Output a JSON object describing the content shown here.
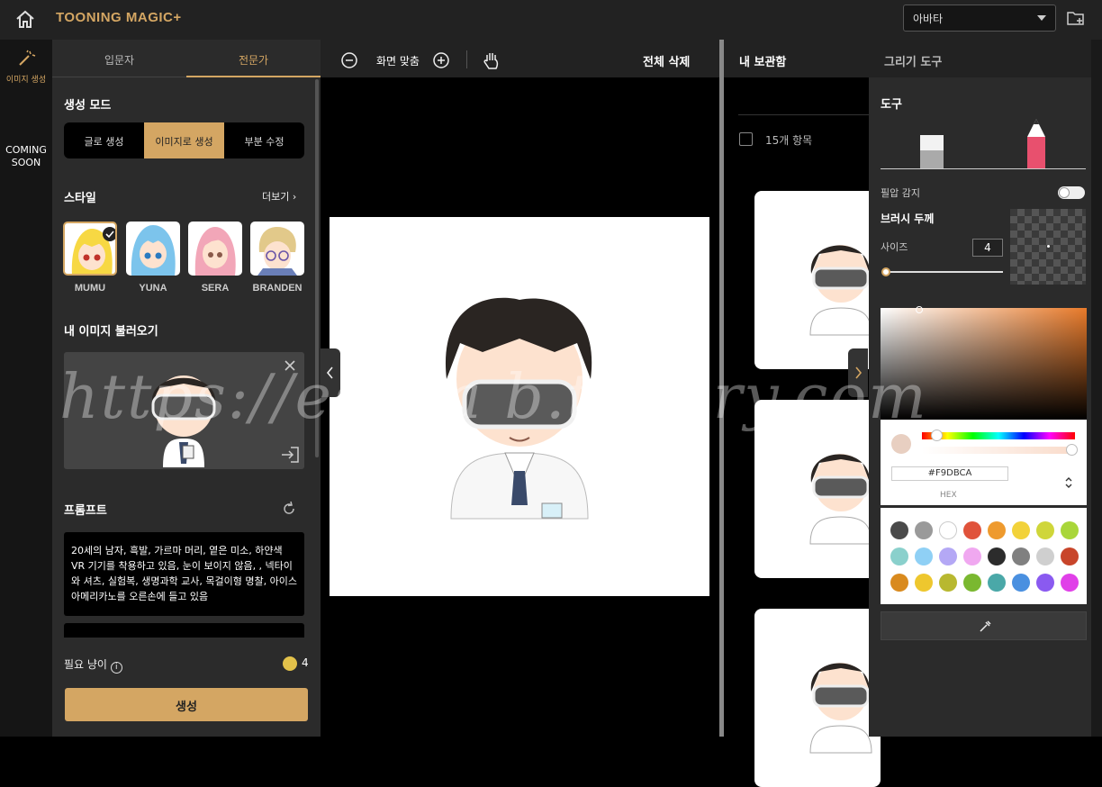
{
  "header": {
    "logo": "TOONING MAGIC+",
    "project_select": "아바타"
  },
  "rail": {
    "items": [
      {
        "label": "이미지 생성"
      }
    ],
    "coming_soon": "COMING SOON"
  },
  "left_panel": {
    "tabs": [
      {
        "label": "입문자"
      },
      {
        "label": "전문가"
      }
    ],
    "mode_title": "생성 모드",
    "modes": [
      {
        "label": "글로 생성"
      },
      {
        "label": "이미지로 생성"
      },
      {
        "label": "부분 수정"
      }
    ],
    "style_title": "스타일",
    "more": "더보기",
    "styles": [
      {
        "name": "MUMU"
      },
      {
        "name": "YUNA"
      },
      {
        "name": "SERA"
      },
      {
        "name": "BRANDEN"
      }
    ],
    "import_title": "내 이미지 불러오기",
    "prompt_title": "프롬프트",
    "prompt_text": "20세의 남자, 흑발, 가르마 머리, 옅은 미소, 하얀색 VR 기기를 착용하고 있음, 눈이 보이지 않음, , 넥타이와 셔츠, 실험복, 생명과학 교사, 목걸이형 명찰, 아이스 아메리카노를 오른손에 들고 있음",
    "cost_label": "필요 냥이",
    "cost_value": "4",
    "generate": "생성"
  },
  "canvas_toolbar": {
    "fit": "화면 맞춤",
    "clear_all": "전체 삭제"
  },
  "library": {
    "tabs": [
      {
        "label": "내 보관함"
      },
      {
        "label": "그리기 도구"
      }
    ],
    "count": "15개 항목"
  },
  "draw_tool": {
    "title": "도구",
    "pressure": "필압 감지",
    "brush_title": "브러시 두께",
    "size_label": "사이즈",
    "size_value": "4",
    "hex_value": "#F9DBCA",
    "hex_label": "HEX"
  },
  "colors": {
    "accent": "#d4a663",
    "current": "#e8cfc1",
    "swatches": [
      "#4a4a4a",
      "#9a9a9a",
      "#ffffff",
      "#e0533b",
      "#ee9a2e",
      "#f2d23a",
      "#cfd63a",
      "#a9d63a",
      "#8ad0cc",
      "#8fd0f5",
      "#b4a8f5",
      "#f0a8f0",
      "#2c2c2c",
      "#808080",
      "#cfcfcf",
      "#c8452a",
      "#d98a1e",
      "#eec72e",
      "#b8b830",
      "#7ab830",
      "#4aa8a8",
      "#4a90e0",
      "#8a5af0",
      "#e040e8"
    ]
  },
  "watermark": "https://escl a b.tistory.com"
}
